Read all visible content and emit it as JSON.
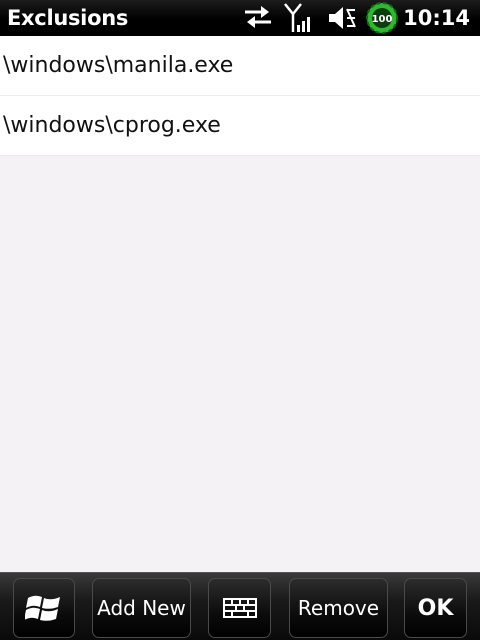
{
  "status_bar": {
    "title": "Exclusions",
    "battery_level": "100",
    "clock": "10:14",
    "icons": [
      "data-connection-icon",
      "signal-strength-icon",
      "speaker-muted-icon",
      "battery-icon"
    ]
  },
  "exclusions": {
    "items": [
      {
        "label": "\\windows\\manila.exe"
      },
      {
        "label": "\\windows\\cprog.exe"
      }
    ]
  },
  "toolbar": {
    "start_icon": "windows-flag-icon",
    "add_new_label": "Add New",
    "keyboard_icon": "keyboard-icon",
    "remove_label": "Remove",
    "ok_label": "OK"
  },
  "colors": {
    "background": "#f5f2f5",
    "list_item_background": "#ffffff",
    "bar_background": "#000000",
    "battery_green": "#2fb82f"
  }
}
